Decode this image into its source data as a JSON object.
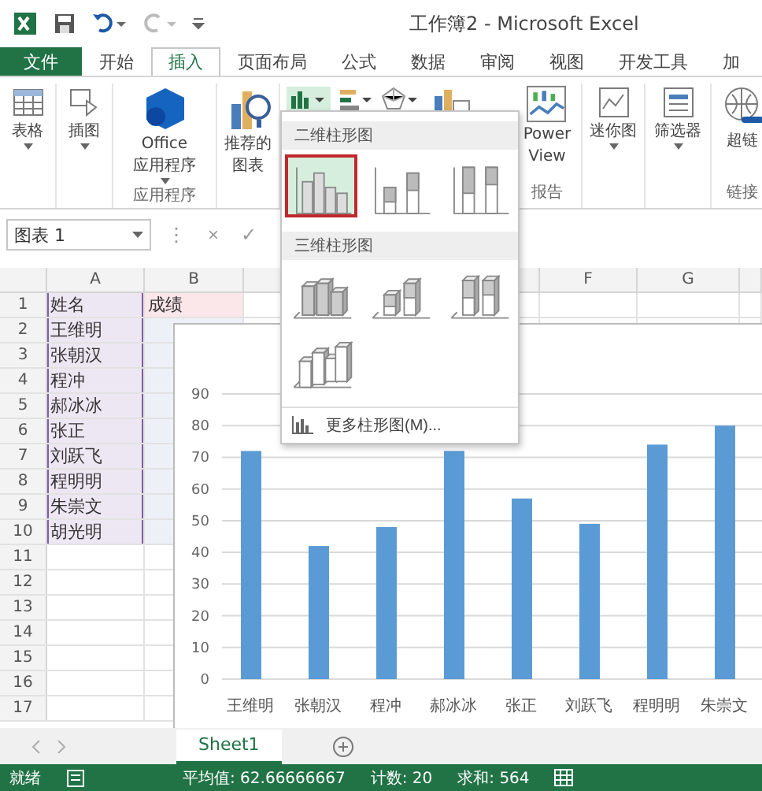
{
  "title_bar": {
    "title": "工作簿2 - Microsoft Excel"
  },
  "ribbon_tabs": [
    {
      "label": "文件",
      "kind": "file",
      "selected": false
    },
    {
      "label": "开始",
      "kind": "tab",
      "selected": false
    },
    {
      "label": "插入",
      "kind": "tab",
      "selected": true
    },
    {
      "label": "页面布局",
      "kind": "tab",
      "selected": false
    },
    {
      "label": "公式",
      "kind": "tab",
      "selected": false
    },
    {
      "label": "数据",
      "kind": "tab",
      "selected": false
    },
    {
      "label": "审阅",
      "kind": "tab",
      "selected": false
    },
    {
      "label": "视图",
      "kind": "tab",
      "selected": false
    },
    {
      "label": "开发工具",
      "kind": "tab",
      "selected": false
    },
    {
      "label": "加",
      "kind": "tab",
      "selected": false
    }
  ],
  "ribbon": [
    {
      "kind": "table",
      "lines": [
        "表格"
      ],
      "dropdown": true
    },
    {
      "kind": "illustration",
      "lines": [
        "插图"
      ],
      "dropdown": true
    },
    {
      "kind": "office",
      "lines": [
        "Office",
        "应用程序"
      ],
      "dropdown": true,
      "group": "应用程序"
    },
    {
      "kind": "recommended",
      "lines": [
        "推荐的",
        "图表"
      ],
      "dropdown": false
    },
    {
      "kind": "chart-types",
      "dropdown": true
    },
    {
      "kind": "power-view",
      "lines": [
        "Power",
        "View"
      ],
      "dropdown": false,
      "group": "报告"
    },
    {
      "kind": "sparkline",
      "lines": [
        "迷你图"
      ],
      "dropdown": true
    },
    {
      "kind": "filter",
      "lines": [
        "筛选器"
      ],
      "dropdown": true
    },
    {
      "kind": "hyperlink",
      "lines": [
        "超链"
      ],
      "dropdown": false,
      "group": "链接"
    }
  ],
  "formula_bar": {
    "name_box": "图表 1",
    "more": "⋮",
    "cancel": "×",
    "enter": "✓"
  },
  "columns": [
    {
      "label": "A",
      "kind": "col"
    },
    {
      "label": "B",
      "kind": "col"
    },
    {
      "kind": "covered"
    },
    {
      "label": "F",
      "kind": "col"
    },
    {
      "label": "G",
      "kind": "col"
    }
  ],
  "rows": [
    {
      "number": "1",
      "a": "姓名",
      "b": "成绩",
      "highlighted": true
    },
    {
      "number": "2",
      "a": "王维明",
      "highlighted": true
    },
    {
      "number": "3",
      "a": "张朝汉",
      "highlighted": true
    },
    {
      "number": "4",
      "a": "程冲",
      "highlighted": true
    },
    {
      "number": "5",
      "a": "郝冰冰",
      "highlighted": true
    },
    {
      "number": "6",
      "a": "张正",
      "highlighted": true
    },
    {
      "number": "7",
      "a": "刘跃飞",
      "highlighted": true
    },
    {
      "number": "8",
      "a": "程明明",
      "highlighted": true
    },
    {
      "number": "9",
      "a": "朱崇文",
      "highlighted": true
    },
    {
      "number": "10",
      "a": "胡光明",
      "highlighted": true
    },
    {
      "number": "11",
      "highlighted": false
    },
    {
      "number": "12",
      "highlighted": false
    },
    {
      "number": "13",
      "highlighted": false
    },
    {
      "number": "14",
      "highlighted": false
    },
    {
      "number": "15",
      "highlighted": false
    },
    {
      "number": "16",
      "highlighted": false
    },
    {
      "number": "17",
      "highlighted": false
    }
  ],
  "chart": {
    "chart_data": {
      "type": "bar",
      "categories": [
        "王维明",
        "张朝汉",
        "程冲",
        "郝冰冰",
        "张正",
        "刘跃飞",
        "程明明",
        "朱崇文"
      ],
      "series": [
        {
          "color": "#5b9bd5",
          "values": [
            72,
            42,
            48,
            72,
            57,
            49,
            74,
            80
          ]
        }
      ],
      "ylim": [
        0,
        90
      ],
      "grid": true,
      "yticks": [
        0,
        10,
        20,
        30,
        40,
        50,
        60,
        70,
        80,
        90
      ]
    }
  },
  "chart_menu": {
    "sections": [
      {
        "title": "二维柱形图",
        "options": [
          {
            "kind": "clustered",
            "selected": true
          },
          {
            "kind": "stacked",
            "selected": false
          },
          {
            "kind": "stacked100",
            "selected": false
          }
        ]
      },
      {
        "title": "三维柱形图",
        "options": [
          {
            "kind": "clustered3d",
            "selected": false
          },
          {
            "kind": "stacked3d",
            "selected": false
          },
          {
            "kind": "stacked3d100",
            "selected": false
          },
          {
            "kind": "column3d",
            "selected": false
          }
        ]
      }
    ],
    "more": "更多柱形图(M)..."
  },
  "sheet_tabs": [
    {
      "label": "Sheet1",
      "selected": true
    }
  ],
  "status_bar": {
    "ready": "就绪",
    "stats": [
      "平均值: 62.66666667",
      "计数: 20",
      "求和: 564"
    ]
  }
}
